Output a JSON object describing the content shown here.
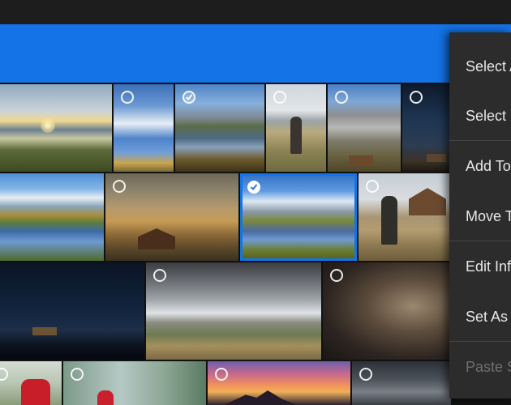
{
  "colors": {
    "accent": "#1473e6",
    "menu_bg": "#2c2c2c",
    "menu_text": "#e8e8e8",
    "menu_disabled": "#6f6f6f"
  },
  "context_menu": {
    "items": [
      {
        "label": "Select A",
        "disabled": false
      },
      {
        "label": "Select I",
        "disabled": false
      },
      {
        "label": "Add To",
        "disabled": false
      },
      {
        "label": "Move T",
        "disabled": false
      },
      {
        "label": "Edit Inf",
        "disabled": false
      },
      {
        "label": "Set As",
        "disabled": false
      },
      {
        "label": "Paste S",
        "disabled": true
      }
    ]
  },
  "photos": [
    {
      "id": "p1",
      "desc": "river-sunburst",
      "checked": false,
      "circle": false,
      "selected": false
    },
    {
      "id": "p2",
      "desc": "blue-sky-clouds",
      "checked": false,
      "circle": true,
      "selected": false
    },
    {
      "id": "p3",
      "desc": "mountain-river",
      "checked": true,
      "circle": true,
      "selected": false
    },
    {
      "id": "p4",
      "desc": "photographer-field",
      "checked": false,
      "circle": true,
      "selected": false
    },
    {
      "id": "p5",
      "desc": "grand-teton-barn",
      "checked": false,
      "circle": true,
      "selected": false
    },
    {
      "id": "p6",
      "desc": "milky-way-barn",
      "checked": false,
      "circle": true,
      "selected": false
    },
    {
      "id": "p7",
      "desc": "teton-reflection",
      "checked": false,
      "circle": false,
      "selected": false
    },
    {
      "id": "p8",
      "desc": "barn-sunrise",
      "checked": false,
      "circle": true,
      "selected": false
    },
    {
      "id": "p9",
      "desc": "mountain-lake-selected",
      "checked": true,
      "circle": true,
      "selected": true
    },
    {
      "id": "p10",
      "desc": "photographer-tripod",
      "checked": false,
      "circle": true,
      "selected": false
    },
    {
      "id": "p11",
      "desc": "night-sky-house",
      "checked": false,
      "circle": false,
      "selected": false
    },
    {
      "id": "p12",
      "desc": "stormy-mountains",
      "checked": false,
      "circle": true,
      "selected": false
    },
    {
      "id": "p13",
      "desc": "revolver",
      "checked": false,
      "circle": true,
      "selected": false
    },
    {
      "id": "p14",
      "desc": "dancer-red",
      "checked": false,
      "circle": true,
      "selected": false
    },
    {
      "id": "p15",
      "desc": "dancer-forest",
      "checked": false,
      "circle": true,
      "selected": false
    },
    {
      "id": "p16",
      "desc": "sunset-peak",
      "checked": false,
      "circle": true,
      "selected": false
    },
    {
      "id": "p17",
      "desc": "dark-clouds",
      "checked": false,
      "circle": true,
      "selected": false
    }
  ]
}
